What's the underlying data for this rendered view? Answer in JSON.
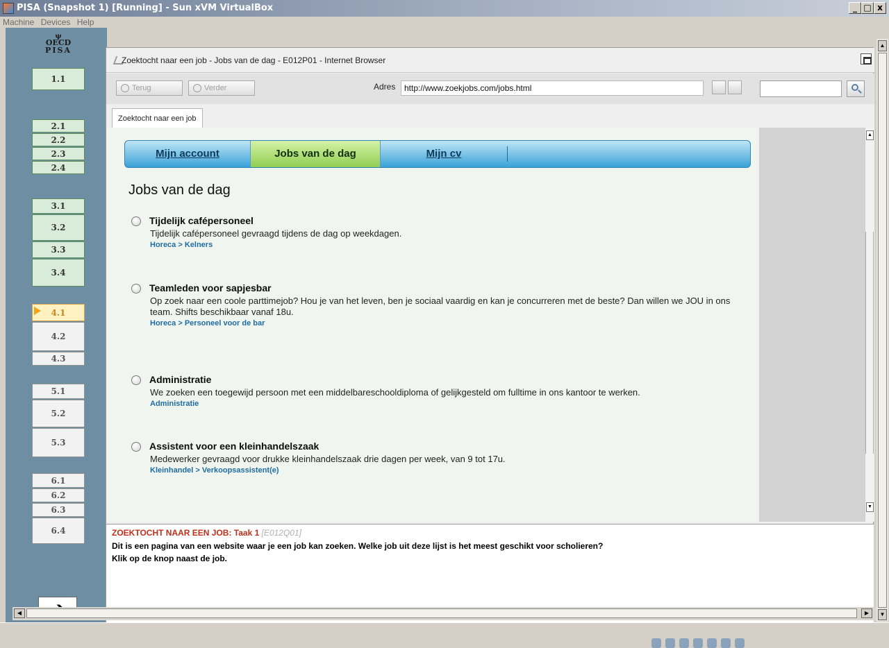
{
  "vm": {
    "title": "PISA (Snapshot 1) [Running] - Sun xVM VirtualBox",
    "menu": [
      "Machine",
      "Devices",
      "Help"
    ],
    "window_buttons": [
      "_",
      "□",
      "x"
    ]
  },
  "nav": {
    "logo_lines": [
      "OECD",
      "PISA"
    ],
    "items": [
      {
        "label": "1.1",
        "state": "green"
      },
      {
        "label": "2.1",
        "state": "green"
      },
      {
        "label": "2.2",
        "state": "green"
      },
      {
        "label": "2.3",
        "state": "green"
      },
      {
        "label": "2.4",
        "state": "green"
      },
      {
        "label": "3.1",
        "state": "green"
      },
      {
        "label": "3.2",
        "state": "green"
      },
      {
        "label": "3.3",
        "state": "green"
      },
      {
        "label": "3.4",
        "state": "green"
      },
      {
        "label": "4.1",
        "state": "active"
      },
      {
        "label": "4.2",
        "state": "white"
      },
      {
        "label": "4.3",
        "state": "white"
      },
      {
        "label": "5.1",
        "state": "white"
      },
      {
        "label": "5.2",
        "state": "white"
      },
      {
        "label": "5.3",
        "state": "white"
      },
      {
        "label": "6.1",
        "state": "white"
      },
      {
        "label": "6.2",
        "state": "white"
      },
      {
        "label": "6.3",
        "state": "white"
      },
      {
        "label": "6.4",
        "state": "white"
      }
    ],
    "next_label": "➔"
  },
  "browser": {
    "title": "Zoektocht naar een job - Jobs van de dag - E012P01 - Internet Browser",
    "back_label": "Terug",
    "forward_label": "Verder",
    "address_label": "Adres",
    "address_value": "http://www.zoekjobs.com/jobs.html",
    "search_value": "",
    "tab_label": "Zoektocht naar een job"
  },
  "site": {
    "nav": [
      {
        "label": "Mijn account",
        "active": false
      },
      {
        "label": "Jobs van de dag",
        "active": true
      },
      {
        "label": "Mijn cv",
        "active": false
      }
    ],
    "heading": "Jobs van de dag",
    "jobs": [
      {
        "title": "Tijdelijk cafépersoneel",
        "description": "Tijdelijk cafépersoneel gevraagd tijdens de dag op weekdagen.",
        "category": "Horeca > Kelners"
      },
      {
        "title": "Teamleden voor sapjesbar",
        "description": "Op zoek naar een coole parttimejob? Hou je van het leven, ben je sociaal vaardig en kan je concurreren met de beste? Dan willen we JOU in ons team. Shifts beschikbaar vanaf 18u.",
        "category": "Horeca > Personeel voor de bar"
      },
      {
        "title": "Administratie",
        "description": "We zoeken een toegewijd persoon met een middelbareschooldiploma of gelijkgesteld om fulltime in ons kantoor te werken.",
        "category": "Administratie"
      },
      {
        "title": "Assistent voor een kleinhandelszaak",
        "description": "Medewerker gevraagd voor drukke kleinhandelszaak drie dagen per week, van 9 tot 17u.",
        "category": "Kleinhandel > Verkoopsassistent(e)"
      }
    ]
  },
  "question": {
    "title": "ZOEKTOCHT NAAR EEN JOB: Taak 1",
    "code": "[E012Q01]",
    "line1": "Dit is een pagina van een website waar je een job kan zoeken. Welke job uit deze lijst is het meest geschikt voor scholieren?",
    "line2": "Klik op de knop naast de job."
  },
  "colors": {
    "accent_blue": "#3aa2d8",
    "active_tab_green": "#8fce52",
    "question_red": "#c02f1a",
    "nav_panel": "#6e8fa3",
    "category_link": "#1f6ca3"
  }
}
